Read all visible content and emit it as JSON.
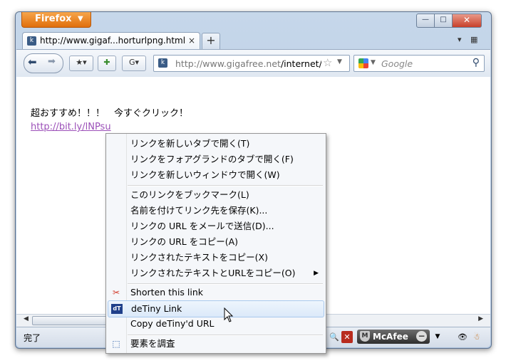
{
  "window": {
    "app_button": "Firefox",
    "controls": {
      "minimize": "—",
      "maximize": "□",
      "close": "✕"
    }
  },
  "tabs": [
    {
      "title": "http://www.gigaf...horturlpng.html",
      "close": "×"
    }
  ],
  "new_tab": "+",
  "navbar": {
    "url_host": "http://www.gigafree.net",
    "url_path": "/internet/f",
    "search_placeholder": "Google"
  },
  "page": {
    "text": "超おすすめ！！！　今すぐクリック！",
    "link": "http://bit.ly/lNPsu"
  },
  "status": {
    "text": "完了",
    "mcafee": "McAfee"
  },
  "context_menu": {
    "items": [
      {
        "label": "リンクを新しいタブで開く(T)"
      },
      {
        "label": "リンクをフォアグランドのタブで開く(F)"
      },
      {
        "label": "リンクを新しいウィンドウで開く(W)"
      },
      {
        "label": "このリンクをブックマーク(L)"
      },
      {
        "label": "名前を付けてリンク先を保存(K)..."
      },
      {
        "label": "リンクの URL をメールで送信(D)..."
      },
      {
        "label": "リンクの URL をコピー(A)"
      },
      {
        "label": "リンクされたテキストをコピー(X)"
      },
      {
        "label": "リンクされたテキストとURLをコピー(O)"
      },
      {
        "label": "Shorten this link",
        "icon": "scissors-icon"
      },
      {
        "label": "deTiny Link",
        "icon": "detiny-icon"
      },
      {
        "label": "Copy deTiny'd URL"
      },
      {
        "label": "要素を調査",
        "icon": "inspect-icon"
      }
    ]
  }
}
